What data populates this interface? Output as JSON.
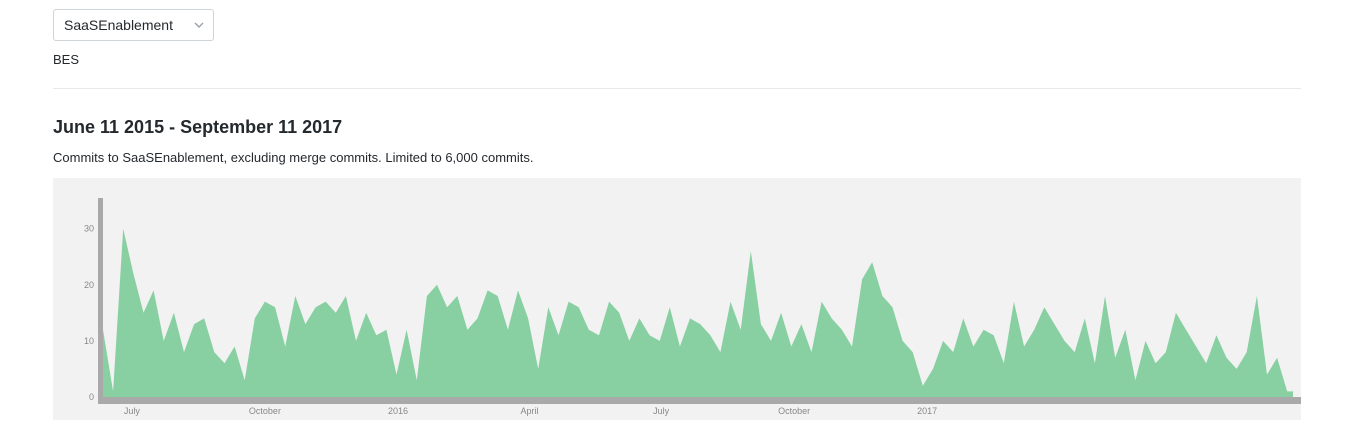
{
  "repo_select": {
    "value": "SaaSEnablement"
  },
  "org_label": "BES",
  "range_title": "June 11 2015 - September 11 2017",
  "description": "Commits to SaaSEnablement, excluding merge commits. Limited to 6,000 commits.",
  "colors": {
    "area": "#88d0a2",
    "axis": "#a9a9a9",
    "panel": "#f2f2f2"
  },
  "chart_data": {
    "type": "area",
    "title": "",
    "xlabel": "",
    "ylabel": "",
    "ylim": [
      0,
      36
    ],
    "yticks": [
      0,
      10,
      20,
      30
    ],
    "xticks": [
      {
        "label": "July",
        "date": "2015-07-01"
      },
      {
        "label": "October",
        "date": "2015-10-01"
      },
      {
        "label": "2016",
        "date": "2016-01-01"
      },
      {
        "label": "April",
        "date": "2016-04-01"
      },
      {
        "label": "July",
        "date": "2016-07-01"
      },
      {
        "label": "October",
        "date": "2016-10-01"
      },
      {
        "label": "2017",
        "date": "2017-01-01"
      }
    ],
    "x_start": "2015-06-11",
    "x_end": "2017-09-11",
    "grid": false,
    "x": [
      "2015-06-11",
      "2015-06-18",
      "2015-06-25",
      "2015-07-02",
      "2015-07-09",
      "2015-07-16",
      "2015-07-23",
      "2015-07-30",
      "2015-08-06",
      "2015-08-13",
      "2015-08-20",
      "2015-08-27",
      "2015-09-03",
      "2015-09-10",
      "2015-09-17",
      "2015-09-24",
      "2015-10-01",
      "2015-10-08",
      "2015-10-15",
      "2015-10-22",
      "2015-10-29",
      "2015-11-05",
      "2015-11-12",
      "2015-11-19",
      "2015-11-26",
      "2015-12-03",
      "2015-12-10",
      "2015-12-17",
      "2015-12-24",
      "2015-12-31",
      "2016-01-07",
      "2016-01-14",
      "2016-01-21",
      "2016-01-28",
      "2016-02-04",
      "2016-02-11",
      "2016-02-18",
      "2016-02-25",
      "2016-03-03",
      "2016-03-10",
      "2016-03-17",
      "2016-03-24",
      "2016-03-31",
      "2016-04-07",
      "2016-04-14",
      "2016-04-21",
      "2016-04-28",
      "2016-05-05",
      "2016-05-12",
      "2016-05-19",
      "2016-05-26",
      "2016-06-02",
      "2016-06-09",
      "2016-06-16",
      "2016-06-23",
      "2016-06-30",
      "2016-07-07",
      "2016-07-14",
      "2016-07-21",
      "2016-07-28",
      "2016-08-04",
      "2016-08-11",
      "2016-08-18",
      "2016-08-25",
      "2016-09-01",
      "2016-09-08",
      "2016-09-15",
      "2016-09-22",
      "2016-09-29",
      "2016-10-06",
      "2016-10-13",
      "2016-10-20",
      "2016-10-27",
      "2016-11-03",
      "2016-11-10",
      "2016-11-17",
      "2016-11-24",
      "2016-12-01",
      "2016-12-08",
      "2016-12-15",
      "2016-12-22",
      "2016-12-29",
      "2017-01-05",
      "2017-01-12",
      "2017-01-19",
      "2017-01-26",
      "2017-02-02",
      "2017-02-09",
      "2017-02-16",
      "2017-02-23",
      "2017-03-02",
      "2017-03-09",
      "2017-03-16",
      "2017-03-23",
      "2017-03-30",
      "2017-04-06",
      "2017-04-13",
      "2017-04-20",
      "2017-04-27",
      "2017-05-04",
      "2017-05-11",
      "2017-05-18",
      "2017-05-25",
      "2017-06-01",
      "2017-06-08",
      "2017-06-15",
      "2017-06-22",
      "2017-06-29",
      "2017-07-06",
      "2017-07-13",
      "2017-07-20",
      "2017-07-27",
      "2017-08-03",
      "2017-08-10",
      "2017-08-17",
      "2017-08-24",
      "2017-08-31",
      "2017-09-07",
      "2017-09-11"
    ],
    "values": [
      12,
      1,
      30,
      22,
      15,
      19,
      10,
      15,
      8,
      13,
      14,
      8,
      6,
      9,
      3,
      14,
      17,
      16,
      9,
      18,
      13,
      16,
      17,
      15,
      18,
      10,
      15,
      11,
      12,
      4,
      12,
      3,
      18,
      20,
      16,
      18,
      12,
      14,
      19,
      18,
      12,
      19,
      14,
      5,
      16,
      11,
      17,
      16,
      12,
      11,
      17,
      15,
      10,
      14,
      11,
      10,
      16,
      9,
      14,
      13,
      11,
      8,
      17,
      12,
      26,
      13,
      10,
      15,
      9,
      13,
      8,
      17,
      14,
      12,
      9,
      21,
      24,
      18,
      16,
      10,
      8,
      2,
      5,
      10,
      8,
      14,
      9,
      12,
      11,
      6,
      17,
      9,
      12,
      16,
      13,
      10,
      8,
      14,
      6,
      18,
      7,
      12,
      3,
      10,
      6,
      8,
      15,
      12,
      9,
      6,
      11,
      7,
      5,
      8,
      18,
      4,
      7,
      1,
      1
    ],
    "series": [
      {
        "name": "",
        "values": "values"
      }
    ]
  }
}
